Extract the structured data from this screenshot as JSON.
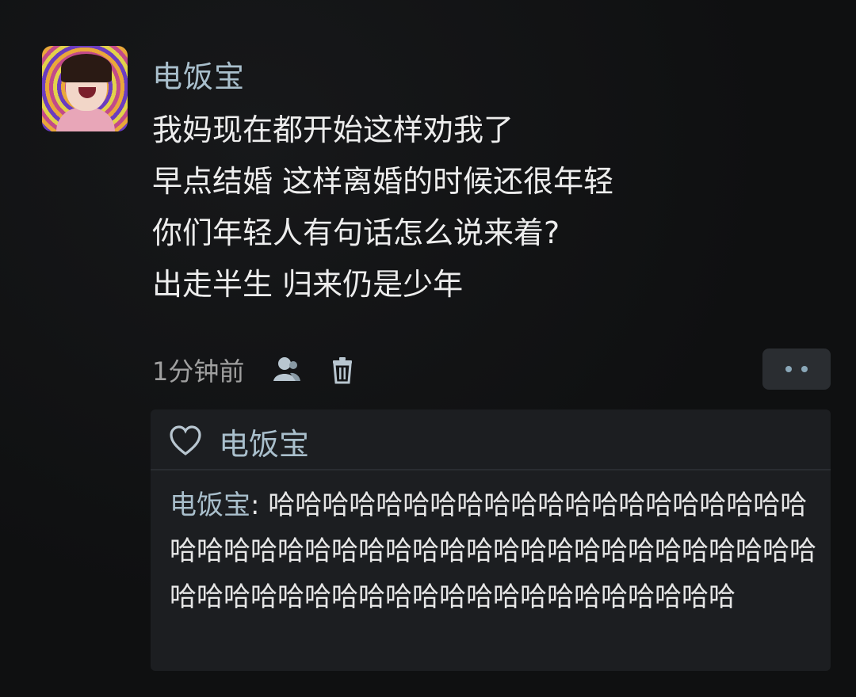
{
  "post": {
    "username": "电饭宝",
    "lines": [
      "我妈现在都开始这样劝我了",
      "早点结婚 这样离婚的时候还很年轻",
      "你们年轻人有句话怎么说来着?",
      "出走半生 归来仍是少年"
    ],
    "time": "1分钟前",
    "icons": {
      "person": "person-icon",
      "trash": "trash-icon",
      "more": "more-dots-icon"
    }
  },
  "reply": {
    "like_icon": "heart-outline-icon",
    "liker_name": "电饭宝",
    "author": "电饭宝",
    "separator": ": ",
    "text": "哈哈哈哈哈哈哈哈哈哈哈哈哈哈哈哈哈哈哈哈哈哈哈哈哈哈哈哈哈哈哈哈哈哈哈哈哈哈哈哈哈哈哈哈哈哈哈哈哈哈哈哈哈哈哈哈哈哈哈哈哈哈哈哈哈"
  },
  "colors": {
    "background": "#0f1011",
    "username": "#a9bfcc",
    "text": "#ededed",
    "muted": "#a0a0a0",
    "reply_bg": "#1c1e21"
  }
}
